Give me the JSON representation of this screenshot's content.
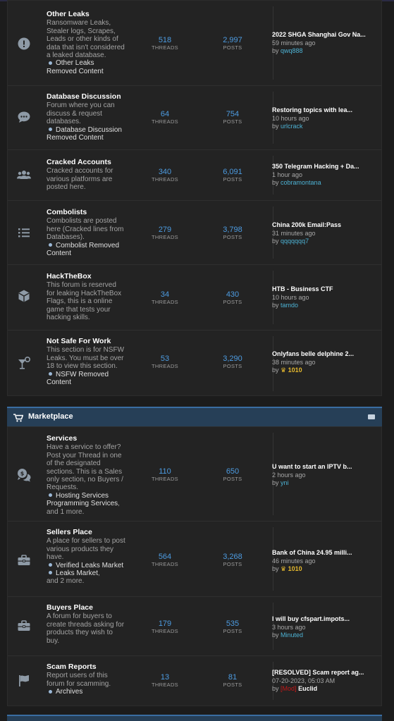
{
  "section1": {
    "forums": [
      {
        "title": "Other Leaks",
        "desc": "Ransomware Leaks, Stealer logs, Scrapes, Leads or other kinds of data that isn't considered a leaked database.",
        "subforums": [
          "Other Leaks Removed Content"
        ],
        "threads": "518",
        "posts": "2,997",
        "latest_title": "2022 SHGA Shanghai Gov Na...",
        "latest_time": "59 minutes ago",
        "latest_user": "qwq888"
      },
      {
        "title": "Database Discussion",
        "desc": "Forum where you can discuss & request databases.",
        "subforums": [
          "Database Discussion Removed Content"
        ],
        "threads": "64",
        "posts": "754",
        "latest_title": "Restoring topics with lea...",
        "latest_time": "10 hours ago",
        "latest_user": "urlcrack"
      },
      {
        "title": "Cracked Accounts",
        "desc": "Cracked accounts for various platforms are posted here.",
        "subforums": [],
        "threads": "340",
        "posts": "6,091",
        "latest_title": "350 Telegram Hacking + Da...",
        "latest_time": "1 hour ago",
        "latest_user": "cobramontana"
      },
      {
        "title": "Combolists",
        "desc": "Combolists are posted here (Cracked lines from Databases).",
        "subforums": [
          "Combolist Removed Content"
        ],
        "threads": "279",
        "posts": "3,798",
        "latest_title": "China 200k Email:Pass",
        "latest_time": "31 minutes ago",
        "latest_user": "qqqqqqq7"
      },
      {
        "title": "HackTheBox",
        "desc": "This forum is reserved for leaking HackTheBox Flags, this is a online game that tests your hacking skills.",
        "subforums": [],
        "threads": "34",
        "posts": "430",
        "latest_title": "HTB - Business CTF",
        "latest_time": "10 hours ago",
        "latest_user": "tamdo"
      },
      {
        "title": "Not Safe For Work",
        "desc": "This section is for NSFW Leaks. You must be over 18 to view this section.",
        "subforums": [
          "NSFW Removed Content"
        ],
        "threads": "53",
        "posts": "3,290",
        "latest_title": "Onlyfans belle delphine 2...",
        "latest_time": "38 minutes ago",
        "latest_user": "1010"
      }
    ]
  },
  "labels": {
    "threads": "THREADS",
    "posts": "POSTS",
    "by": "by",
    "more_suffix": "and 1 more.",
    "more_suffix2": "and 2 more."
  },
  "marketplace": {
    "title": "Marketplace",
    "forums": [
      {
        "title": "Services",
        "desc": "Have a service to offer? Post your Thread in one of the designated sections. This is a Sales only section, no Buyers / Requests.",
        "subforums": [
          "Hosting Services",
          "Programming Services"
        ],
        "more": "and 1 more.",
        "threads": "110",
        "posts": "650",
        "latest_title": "U want to start an IPTV b...",
        "latest_time": "2 hours ago",
        "latest_user": "yni"
      },
      {
        "title": "Sellers Place",
        "desc": "A place for sellers to post various products they have.",
        "subforums": [
          "Verified Leaks Market",
          "Leaks Market"
        ],
        "more": "and 2 more.",
        "threads": "564",
        "posts": "3,268",
        "latest_title": "Bank of China 24.95 milli...",
        "latest_time": "46 minutes ago",
        "latest_user": "1010"
      },
      {
        "title": "Buyers Place",
        "desc": "A forum for buyers to create threads asking for products they wish to buy.",
        "subforums": [],
        "threads": "179",
        "posts": "535",
        "latest_title": "I will buy cfspart.impots...",
        "latest_time": "3 hours ago",
        "latest_user": "Minuted"
      },
      {
        "title": "Scam Reports",
        "desc": "Report users of this forum for scamming.",
        "subforums": [
          "Archives"
        ],
        "threads": "13",
        "posts": "81",
        "latest_title": "[RESOLVED] Scam report ag...",
        "latest_time": "07-20-2023, 05:03 AM",
        "latest_user": "Euclid",
        "latest_user_tag": "[Mod]"
      }
    ]
  },
  "colors": {
    "accent": "#4d9ce2",
    "header": "#263f57",
    "username": "#4db2d4",
    "gold": "#e5b92e",
    "mod": "#c41818"
  },
  "icons": [
    "exclamation-circle-icon",
    "chat-bubble-icon",
    "users-icon",
    "list-icon",
    "cube-icon",
    "cocktail-icon",
    "cart-icon",
    "money-chat-icon",
    "briefcase-icon",
    "briefcase-icon",
    "flag-icon"
  ]
}
